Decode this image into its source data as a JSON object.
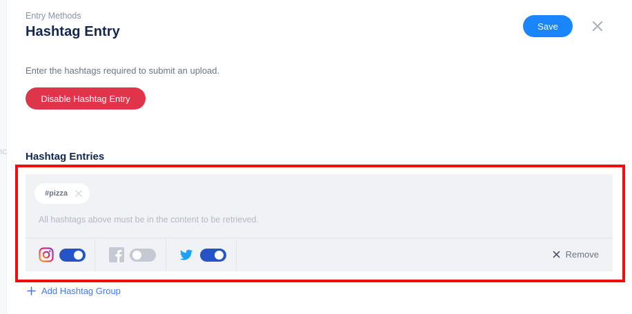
{
  "header": {
    "eyebrow": "Entry Methods",
    "title": "Hashtag Entry",
    "save_label": "Save"
  },
  "description": "Enter the hashtags required to submit an upload.",
  "disable_label": "Disable Hashtag Entry",
  "section_title": "Hashtag Entries",
  "groups": [
    {
      "tags": [
        "#pizza"
      ],
      "hint": "All hashtags above must be in the content to be retrieved.",
      "networks": [
        {
          "name": "instagram-icon",
          "enabled": true
        },
        {
          "name": "facebook-icon",
          "enabled": false
        },
        {
          "name": "twitter-icon",
          "enabled": true
        }
      ],
      "remove_label": "Remove"
    }
  ],
  "add_group_label": "Add Hashtag Group",
  "side_fragment": "nc",
  "colors": {
    "primary": "#1a85ff",
    "danger": "#e0344a",
    "toggle_on": "#2454c6",
    "toggle_off": "#c4c9d3",
    "highlight": "#ee0e0e"
  }
}
